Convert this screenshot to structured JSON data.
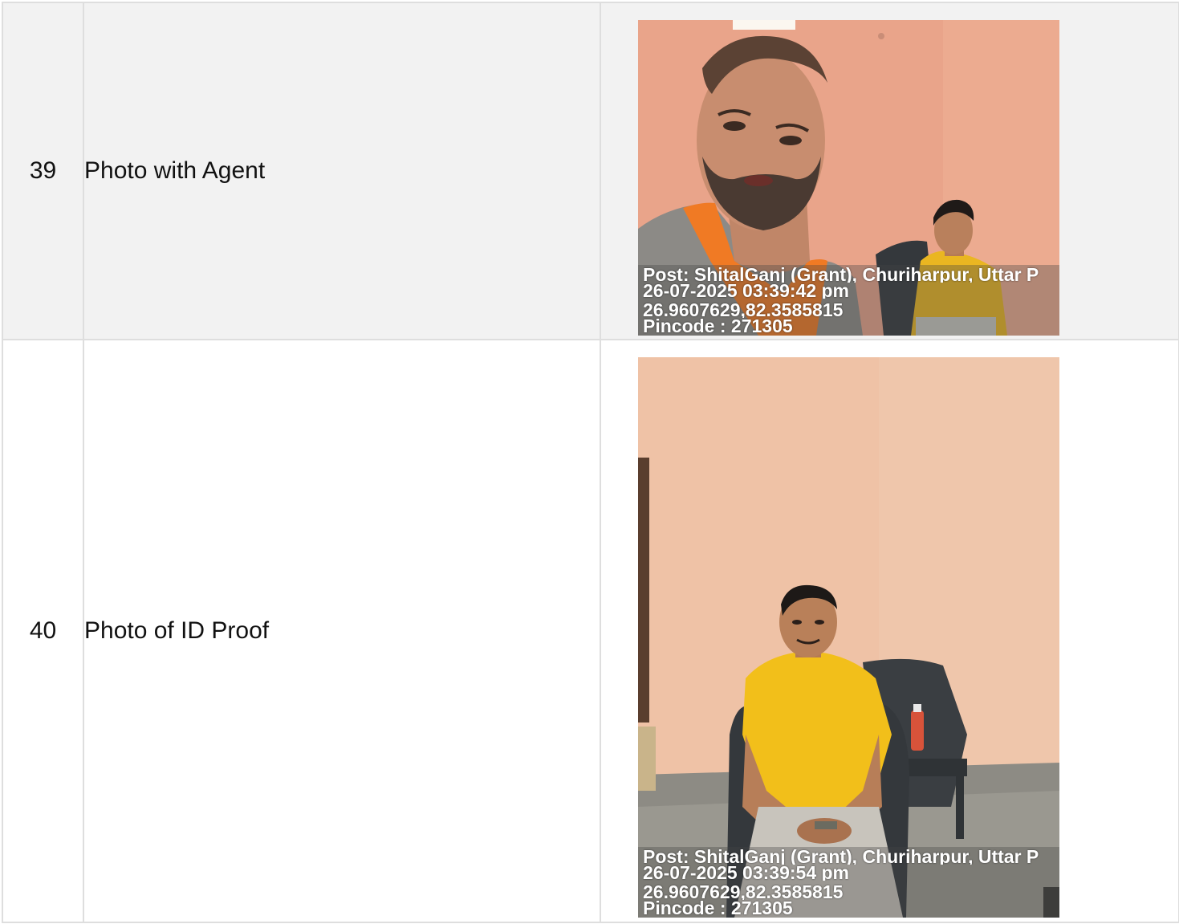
{
  "rows": [
    {
      "number": "39",
      "label": "Photo with Agent",
      "photo": {
        "alt": "Photo with Agent",
        "stamp": {
          "post": "Post: ShitalGanj (Grant), Churiharpur, Uttar P",
          "datetime": "26-07-2025 03:39:42 pm",
          "coords": "26.9607629,82.3585815",
          "pincode": "Pincode : 271305"
        }
      }
    },
    {
      "number": "40",
      "label": "Photo of ID Proof",
      "photo": {
        "alt": "Photo of ID Proof",
        "stamp": {
          "post": "Post: ShitalGanj (Grant), Churiharpur, Uttar P",
          "datetime": "26-07-2025 03:39:54 pm",
          "coords": "26.9607629,82.3585815",
          "pincode": "Pincode : 271305"
        }
      }
    }
  ],
  "colors": {
    "wall_39": "#e9a48a",
    "wall_40": "#efc2a6",
    "shirt_yellow": "#f2bf1a",
    "chair": "#3a3e42",
    "floor": "#9a9890",
    "border": "#dedede",
    "row_shade": "#f2f2f2"
  }
}
